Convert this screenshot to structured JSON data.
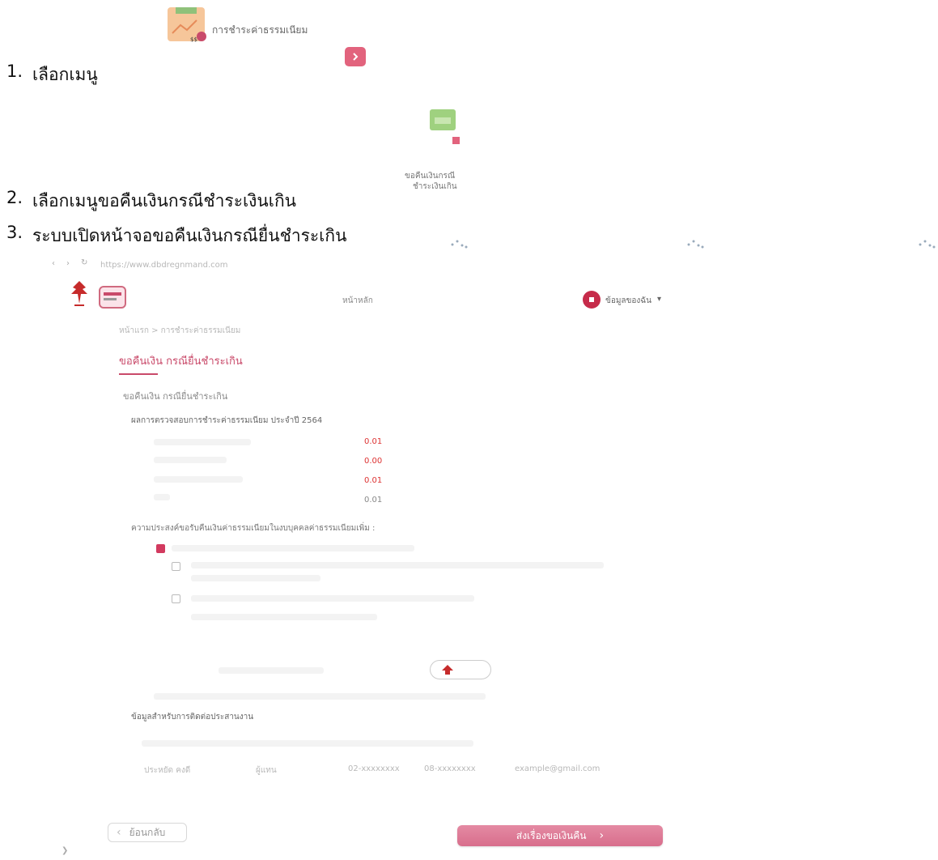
{
  "step1": {
    "number": "1.",
    "label": "เลือกเมนู",
    "menu_label": "การชำระค่าธรรมเนียม"
  },
  "step2": {
    "number": "2.",
    "label": "เลือกเมนูขอคืนเงินกรณีชำระเงินเกิน",
    "tile_line1": "ขอคืนเงินกรณี",
    "tile_line2": "ชำระเงินเกิน"
  },
  "step3": {
    "number": "3.",
    "label": "ระบบเปิดหน้าจอขอคืนเงินกรณียื่นชำระเกิน"
  },
  "browser": {
    "url": "https://www.dbdregnmand.com"
  },
  "header": {
    "nav_home": "หน้าหลัก",
    "user_menu": "ข้อมูลของฉัน"
  },
  "breadcrumb": {
    "text": "หน้าแรก > การชำระค่าธรรมเนียม"
  },
  "page": {
    "title": "ขอคืนเงิน กรณียื่นชำระเกิน",
    "section_title": "ขอคืนเงิน กรณียื่นชำระเกิน",
    "summary_title": "ผลการตรวจสอบการชำระค่าธรรมเนียม ประจำปี 2564",
    "amounts": [
      "0.01",
      "0.00",
      "0.01",
      "0.01"
    ],
    "question": "ความประสงค์ขอรับคืนเงินค่าธรรมเนียมในงบบุคคลค่าธรรมเนียมเพิ่ม :"
  },
  "contact": {
    "heading": "ข้อมูลสำหรับการติดต่อประสานงาน",
    "name": "ประหยัด คงดี",
    "position": "ผู้แทน",
    "phone1": "02-xxxxxxxx",
    "phone2": "08-xxxxxxxx",
    "email": "example@gmail.com"
  },
  "buttons": {
    "back": "ย้อนกลับ",
    "submit": "ส่งเรื่องขอเงินคืน"
  },
  "colors": {
    "accent": "#d23a5f",
    "submit_bg": "#dd7894"
  }
}
